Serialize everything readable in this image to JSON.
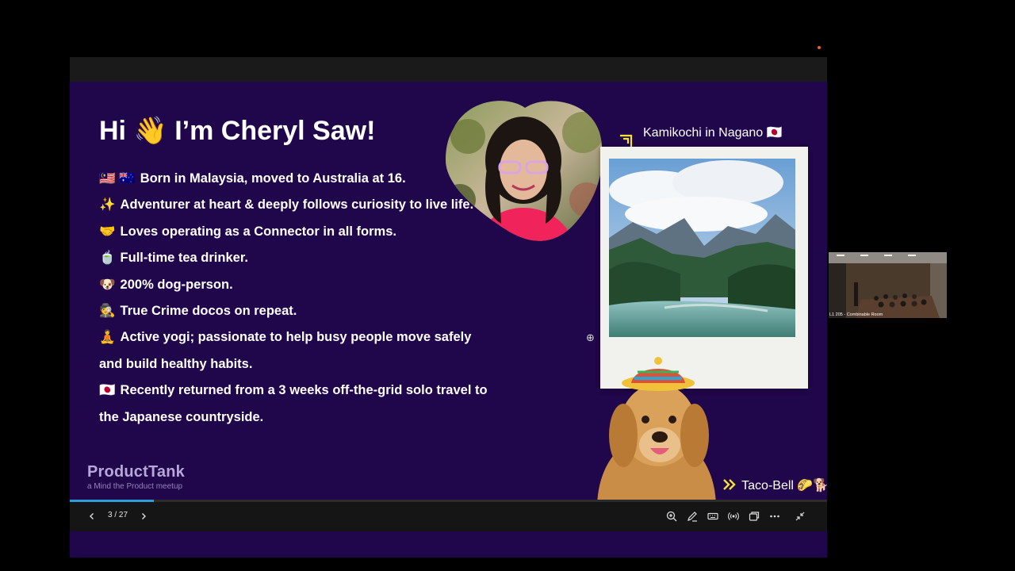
{
  "slide": {
    "title": "Hi 👋 I’m Cheryl Saw!",
    "bullets": [
      {
        "emoji": "🇲🇾 🇦🇺",
        "text": "Born in Malaysia, moved to Australia at 16."
      },
      {
        "emoji": "✨",
        "text": "Adventurer at heart & deeply follows curiosity to live life."
      },
      {
        "emoji": "🤝",
        "text": "Loves operating as a Connector in all forms."
      },
      {
        "emoji": "🍵",
        "text": "Full-time tea drinker."
      },
      {
        "emoji": "🐶",
        "text": "200% dog-person."
      },
      {
        "emoji": "🕵️",
        "text": "True Crime docos on repeat."
      },
      {
        "emoji": "🧘",
        "text": "Active yogi; passionate to help busy people move safely and build healthy habits."
      },
      {
        "emoji": "🇯🇵",
        "text": "Recently returned from a 3 weeks off-the-grid solo travel to the Japanese countryside."
      }
    ],
    "caption_photo": "Kamikochi in Nagano 🇯🇵",
    "caption_dog": "Taco-Bell 🌮🐕",
    "logo": {
      "name": "ProductTank",
      "tagline": "a Mind the Product meetup"
    }
  },
  "viewer": {
    "page_indicator": "3 / 27",
    "progress": 0.111,
    "prev_icon": "chevron-left-icon",
    "next_icon": "chevron-right-icon",
    "tools": [
      "zoom-in-icon",
      "pen-icon",
      "keyboard-icon",
      "broadcast-icon",
      "window-icon",
      "more-icon",
      "exit-fullscreen-icon"
    ]
  },
  "participant": {
    "label": "L1 205 - Combinable Room"
  },
  "colors": {
    "slide_bg": "#20064a",
    "accent_yellow": "#f5e13a",
    "progress": "#2d9cdb",
    "logo": "#b7a8d9"
  }
}
